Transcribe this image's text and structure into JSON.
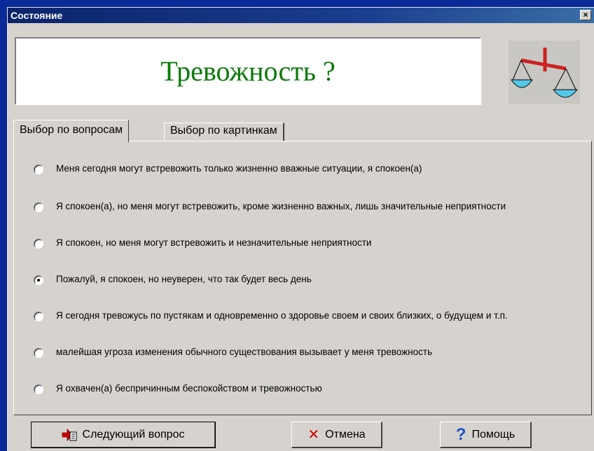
{
  "window": {
    "title": "Состояние",
    "close_label": "×"
  },
  "header": {
    "title": "Тревожность ?",
    "title_color": "#0a7a0a",
    "icon": "scales-icon"
  },
  "tabs": [
    {
      "label": "Выбор по вопросам",
      "active": true
    },
    {
      "label": "Выбор по картинкам",
      "active": false
    }
  ],
  "options": [
    {
      "label": "Меня сегодня могут встревожить только жизненно вважные ситуации, я спокоен(а)",
      "checked": false
    },
    {
      "label": "Я спокоен(а), но меня могут встревожить, кроме жизненно важных, лишь значительные неприятности",
      "checked": false
    },
    {
      "label": "Я спокоен, но меня могут встревожить и незначительные неприятности",
      "checked": false
    },
    {
      "label": "Пожалуй, я спокоен, но неуверен, что так будет весь день",
      "checked": true
    },
    {
      "label": "Я сегодня тревожусь по пустякам и одновременно о здоровье своем и своих близких, о будущем и т.п.",
      "checked": false
    },
    {
      "label": "малейшая угроза изменения обычного существования вызывает у меня тревожность",
      "checked": false
    },
    {
      "label": "Я охвачен(а) беспричинным беспокойством и тревожностью",
      "checked": false
    }
  ],
  "buttons": {
    "next_label": "Следующий вопрос",
    "cancel_label": "Отмена",
    "help_label": "Помощь",
    "help_glyph": "?"
  }
}
